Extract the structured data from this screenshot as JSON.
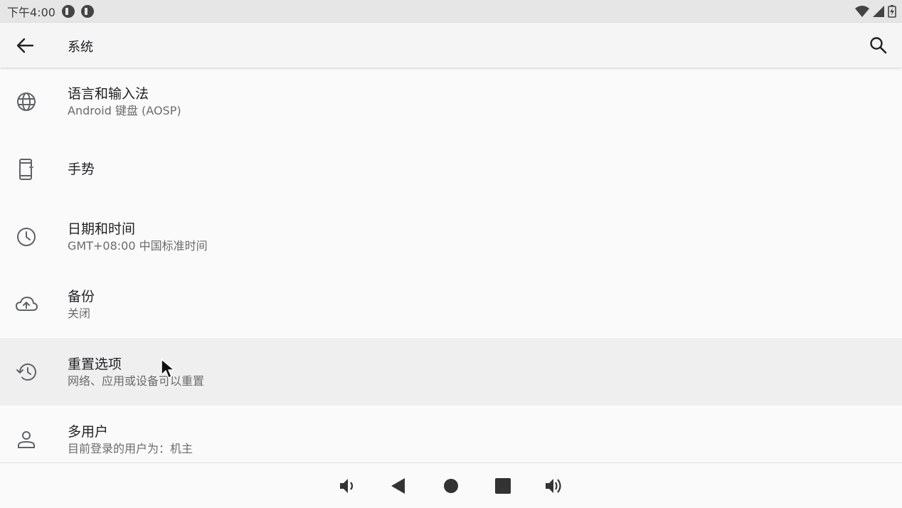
{
  "status_bar": {
    "time": "下午4:00",
    "app_icons": [
      "app-notification-icon",
      "app-notification-icon"
    ],
    "right_icons": [
      "wifi-icon",
      "cell-signal-icon",
      "battery-charging-icon"
    ]
  },
  "app_bar": {
    "title": "系统",
    "back_icon": "arrow-left-icon",
    "search_icon": "search-icon"
  },
  "settings": [
    {
      "id": "languages",
      "icon": "globe-icon",
      "title": "语言和输入法",
      "subtitle": "Android 键盘 (AOSP)"
    },
    {
      "id": "gestures",
      "icon": "phone-gesture-icon",
      "title": "手势",
      "subtitle": ""
    },
    {
      "id": "date-time",
      "icon": "clock-icon",
      "title": "日期和时间",
      "subtitle": "GMT+08:00 中国标准时间"
    },
    {
      "id": "backup",
      "icon": "cloud-upload-icon",
      "title": "备份",
      "subtitle": "关闭"
    },
    {
      "id": "reset",
      "icon": "history-icon",
      "title": "重置选项",
      "subtitle": "网络、应用或设备可以重置",
      "highlighted": true
    },
    {
      "id": "multi-user",
      "icon": "person-icon",
      "title": "多用户",
      "subtitle": "目前登录的用户为：机主"
    }
  ],
  "nav_bar": {
    "buttons": [
      "volume-down-icon",
      "back-triangle-icon",
      "home-circle-icon",
      "recents-square-icon",
      "volume-up-icon"
    ]
  },
  "colors": {
    "background": "#fafafa",
    "status_bar": "#e6e6e6",
    "app_bar": "#f5f5f5",
    "highlight_row": "#efefef",
    "icon": "#5f6368",
    "primary_text": "#202124",
    "secondary_text": "#6b6b6b"
  }
}
